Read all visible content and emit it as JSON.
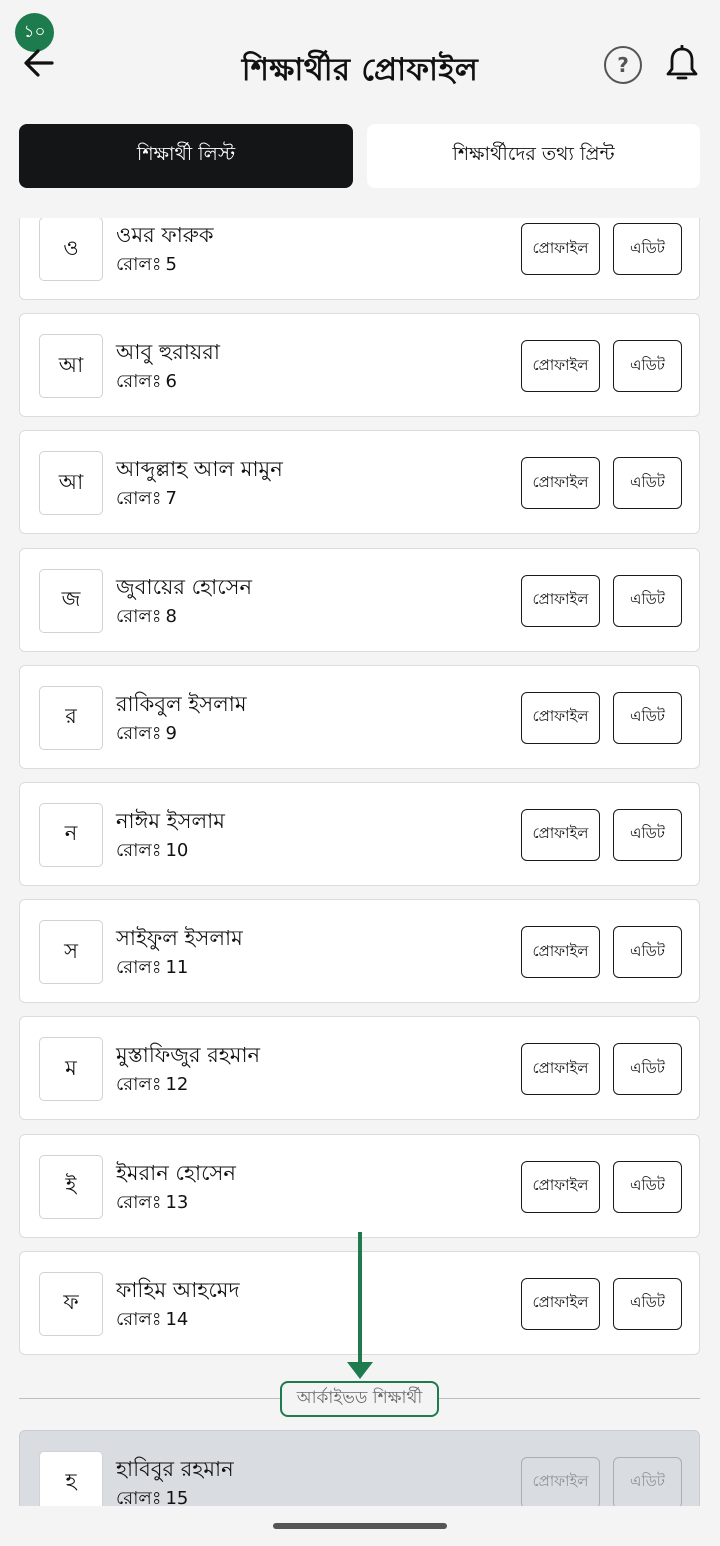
{
  "step_badge": "১০",
  "header": {
    "title": "শিক্ষার্থীর প্রোফাইল",
    "help_symbol": "?",
    "icons": {
      "back": "arrow-left-icon",
      "help": "question-circle-icon",
      "notifications": "bell-icon"
    }
  },
  "tabs": [
    {
      "label": "শিক্ষার্থী লিস্ট",
      "active": true
    },
    {
      "label": "শিক্ষার্থীদের তথ্য প্রিন্ট",
      "active": false
    }
  ],
  "roll_label": "রোলঃ",
  "profile_button_label": "প্রোফাইল",
  "edit_button_label": "এডিট",
  "students": [
    {
      "initial": "ও",
      "name": "ওমর ফারুক",
      "roll": "5"
    },
    {
      "initial": "আ",
      "name": "আবু হুরায়রা",
      "roll": "6"
    },
    {
      "initial": "আ",
      "name": "আব্দুল্লাহ আল মামুন",
      "roll": "7"
    },
    {
      "initial": "জ",
      "name": "জুবায়ের হোসেন",
      "roll": "8"
    },
    {
      "initial": "র",
      "name": "রাকিবুল ইসলাম",
      "roll": "9"
    },
    {
      "initial": "ন",
      "name": "নাঈম ইসলাম",
      "roll": "10"
    },
    {
      "initial": "স",
      "name": "সাইফুল ইসলাম",
      "roll": "11"
    },
    {
      "initial": "ম",
      "name": "মুস্তাফিজুর রহমান",
      "roll": "12"
    },
    {
      "initial": "ই",
      "name": "ইমরান হোসেন",
      "roll": "13"
    },
    {
      "initial": "ফ",
      "name": "ফাহিম আহমেদ",
      "roll": "14"
    }
  ],
  "archive_section_label": "আর্কাইভড শিক্ষার্থী",
  "archived_students": [
    {
      "initial": "হ",
      "name": "হাবিবুর রহমান",
      "roll": "15"
    }
  ],
  "colors": {
    "accent": "#1d7b4e",
    "active_tab": "#131517",
    "archived_card": "#d9dde1"
  }
}
